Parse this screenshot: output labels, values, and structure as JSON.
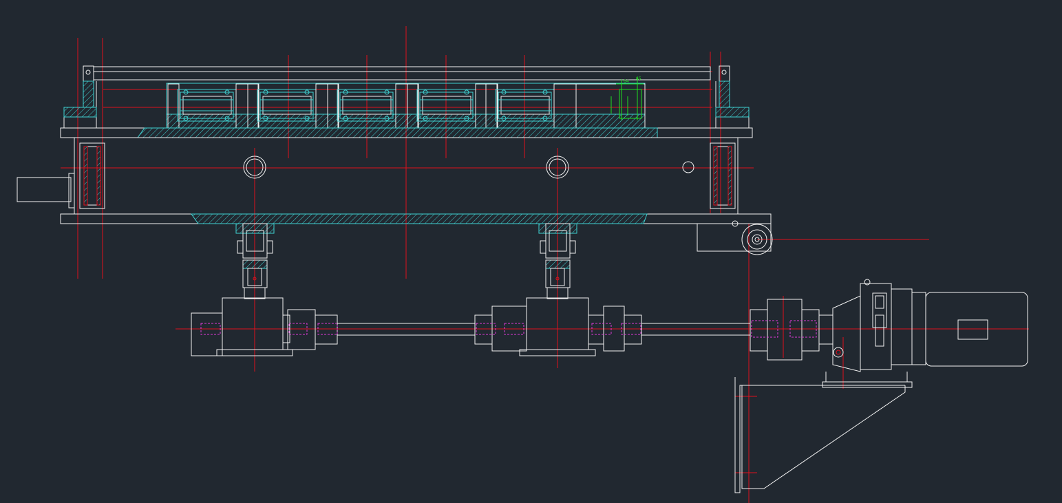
{
  "canvas": {
    "background": "#212830"
  },
  "palette": {
    "outline": "#f2f2f2",
    "centerline": "#e0111d",
    "hatch": "#3fd2d2",
    "dimension": "#20e020",
    "hidden_line": "#e03ad8"
  },
  "dimensions": {
    "label_a": "64",
    "label_b": "65"
  }
}
